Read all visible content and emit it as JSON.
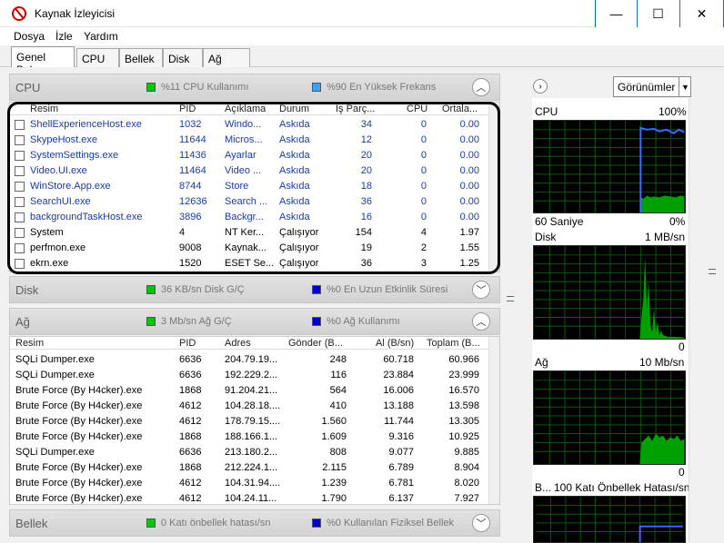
{
  "window": {
    "title": "Kaynak İzleyicisi",
    "min": "—",
    "max": "☐",
    "close": "✕"
  },
  "menu": [
    "Dosya",
    "İzle",
    "Yardım"
  ],
  "tabs": [
    "Genel Bakış",
    "CPU",
    "Bellek",
    "Disk",
    "Ağ"
  ],
  "cpu": {
    "title": "CPU",
    "legend1": "%11 CPU Kullanımı",
    "legend2": "%90 En Yüksek Frekans",
    "columns": [
      "Resim",
      "PID",
      "Açıklama",
      "Durum",
      "İş Parç...",
      "CPU",
      "Ortala..."
    ],
    "rows": [
      [
        "ShellExperienceHost.exe",
        "1032",
        "Windo...",
        "Askıda",
        "34",
        "0",
        "0.00"
      ],
      [
        "SkypeHost.exe",
        "11644",
        "Micros...",
        "Askıda",
        "12",
        "0",
        "0.00"
      ],
      [
        "SystemSettings.exe",
        "11436",
        "Ayarlar",
        "Askıda",
        "20",
        "0",
        "0.00"
      ],
      [
        "Video.UI.exe",
        "11464",
        "Video ...",
        "Askıda",
        "20",
        "0",
        "0.00"
      ],
      [
        "WinStore.App.exe",
        "8744",
        "Store",
        "Askıda",
        "18",
        "0",
        "0.00"
      ],
      [
        "SearchUI.exe",
        "12636",
        "Search ...",
        "Askıda",
        "36",
        "0",
        "0.00"
      ],
      [
        "backgroundTaskHost.exe",
        "3896",
        "Backgr...",
        "Askıda",
        "16",
        "0",
        "0.00"
      ],
      [
        "System",
        "4",
        "NT Ker...",
        "Çalışıyor",
        "154",
        "4",
        "1.97"
      ],
      [
        "perfmon.exe",
        "9008",
        "Kaynak...",
        "Çalışıyor",
        "19",
        "2",
        "1.55"
      ],
      [
        "ekrn.exe",
        "1520",
        "ESET Se...",
        "Çalışıyor",
        "36",
        "3",
        "1.25"
      ]
    ]
  },
  "disk": {
    "title": "Disk",
    "legend1": "36 KB/sn Disk G/Ç",
    "legend2": "%0 En Uzun Etkinlik Süresi"
  },
  "net": {
    "title": "Ağ",
    "legend1": "3 Mb/sn Ağ G/Ç",
    "legend2": "%0 Ağ Kullanımı",
    "columns": [
      "Resim",
      "PID",
      "Adres",
      "Gönder (B...",
      "Al (B/sn)",
      "Toplam (B..."
    ],
    "rows": [
      [
        "SQLi Dumper.exe",
        "6636",
        "204.79.19...",
        "248",
        "60.718",
        "60.966"
      ],
      [
        "SQLi Dumper.exe",
        "6636",
        "192.229.2...",
        "116",
        "23.884",
        "23.999"
      ],
      [
        "Brute Force (By H4cker).exe",
        "1868",
        "91.204.21...",
        "564",
        "16.006",
        "16.570"
      ],
      [
        "Brute Force (By H4cker).exe",
        "4612",
        "104.28.18....",
        "410",
        "13.188",
        "13.598"
      ],
      [
        "Brute Force (By H4cker).exe",
        "4612",
        "178.79.15....",
        "1.560",
        "11.744",
        "13.305"
      ],
      [
        "Brute Force (By H4cker).exe",
        "1868",
        "188.166.1...",
        "1.609",
        "9.316",
        "10.925"
      ],
      [
        "SQLi Dumper.exe",
        "6636",
        "213.180.2...",
        "808",
        "9.077",
        "9.885"
      ],
      [
        "Brute Force (By H4cker).exe",
        "1868",
        "212.224.1...",
        "2.115",
        "6.789",
        "8.904"
      ],
      [
        "Brute Force (By H4cker).exe",
        "4612",
        "104.31.94....",
        "1.239",
        "6.781",
        "8.020"
      ],
      [
        "Brute Force (By H4cker).exe",
        "4612",
        "104.24.11...",
        "1.790",
        "6.137",
        "7.927"
      ]
    ]
  },
  "memory": {
    "title": "Bellek",
    "legend1": "0 Katı önbellek hatası/sn",
    "legend2": "%0 Kullanılan Fiziksel Bellek"
  },
  "right": {
    "views_label": "Görünümler",
    "cpu_label": "CPU",
    "cpu_max": "100%",
    "cpu_time": "60 Saniye",
    "cpu_min": "0%",
    "disk_label": "Disk",
    "disk_max": "1 MB/sn",
    "disk_min": "0",
    "net_label": "Ağ",
    "net_max": "10 Mb/sn",
    "net_min": "0",
    "mem_label": "B...",
    "mem_max": "100 Katı Önbellek Hatası/sn"
  },
  "colors": {
    "green": "#00c800",
    "blue": "#0000c8",
    "accent": "#0072c6"
  }
}
